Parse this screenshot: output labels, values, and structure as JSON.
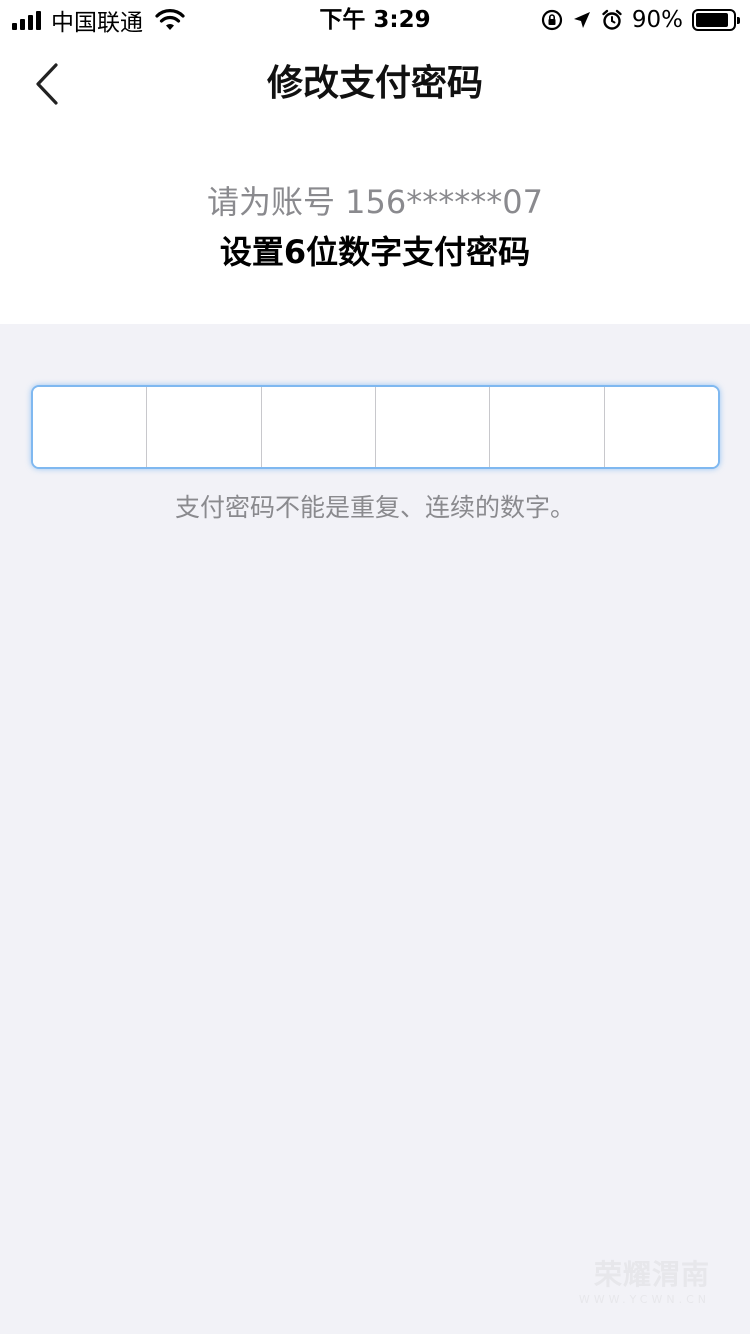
{
  "status_bar": {
    "carrier": "中国联通",
    "time": "下午 3:29",
    "battery_percent": "90%",
    "battery_level": 0.9,
    "icons": [
      "signal-icon",
      "wifi-icon",
      "rotation-lock-icon",
      "location-icon",
      "alarm-icon",
      "battery-icon"
    ]
  },
  "nav": {
    "title": "修改支付密码",
    "back_icon": "chevron-left-icon"
  },
  "prompt": {
    "line1": "请为账号 156******07",
    "line2": "设置6位数字支付密码"
  },
  "pin": {
    "length": 6,
    "filled": 0,
    "accent_color": "#7fb8f0"
  },
  "hint": "支付密码不能是重复、连续的数字。",
  "watermark": {
    "main": "荣耀渭南",
    "sub": "WWW.YCWN.CN"
  },
  "colors": {
    "background": "#f2f2f7",
    "header_background": "#ffffff",
    "secondary_text": "#8a8a8e"
  }
}
